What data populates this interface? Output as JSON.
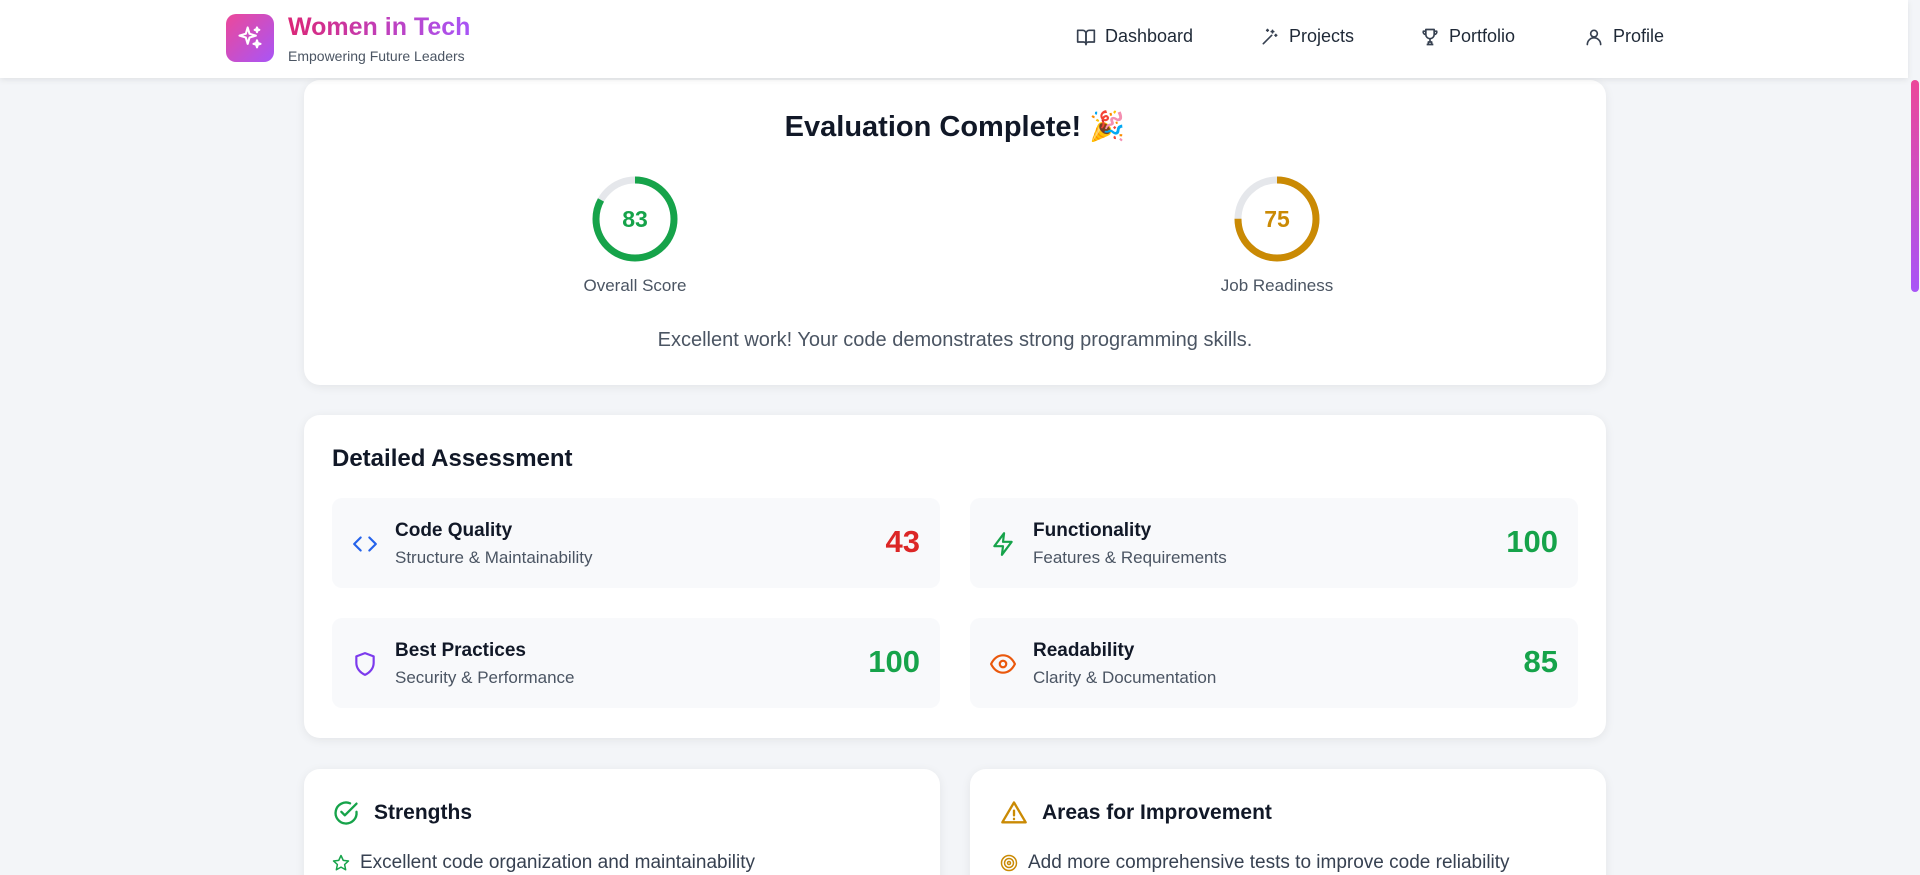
{
  "brand": {
    "title": "Women in Tech",
    "subtitle": "Empowering Future Leaders",
    "logo_icon": "sparkles-icon"
  },
  "nav": [
    {
      "label": "Dashboard",
      "icon": "book-open-icon"
    },
    {
      "label": "Projects",
      "icon": "wand-icon"
    },
    {
      "label": "Portfolio",
      "icon": "trophy-icon"
    },
    {
      "label": "Profile",
      "icon": "user-icon"
    }
  ],
  "evaluation": {
    "title": "Evaluation Complete! 🎉",
    "overall": {
      "value": 83,
      "label": "Overall Score",
      "color": "#16a34a"
    },
    "job_readiness": {
      "value": 75,
      "label": "Job Readiness",
      "color": "#ca8a04"
    },
    "message": "Excellent work! Your code demonstrates strong programming skills."
  },
  "assessment": {
    "title": "Detailed Assessment",
    "metrics": [
      {
        "name": "Code Quality",
        "sub": "Structure & Maintainability",
        "value": "43",
        "icon": "code-icon",
        "icon_color": "#2563eb",
        "value_color": "#dc2626"
      },
      {
        "name": "Functionality",
        "sub": "Features & Requirements",
        "value": "100",
        "icon": "zap-icon",
        "icon_color": "#16a34a",
        "value_color": "#16a34a"
      },
      {
        "name": "Best Practices",
        "sub": "Security & Performance",
        "value": "100",
        "icon": "shield-icon",
        "icon_color": "#7c3aed",
        "value_color": "#16a34a"
      },
      {
        "name": "Readability",
        "sub": "Clarity & Documentation",
        "value": "85",
        "icon": "eye-icon",
        "icon_color": "#ea580c",
        "value_color": "#16a34a"
      }
    ]
  },
  "strengths": {
    "title": "Strengths",
    "icon": "check-circle-icon",
    "items": [
      "Excellent code organization and maintainability"
    ]
  },
  "improvements": {
    "title": "Areas for Improvement",
    "icon": "alert-triangle-icon",
    "items": [
      "Add more comprehensive tests to improve code reliability"
    ]
  },
  "colors": {
    "accent_pink": "#ec4899",
    "accent_purple": "#a855f7",
    "ring_track": "#e5e7eb"
  }
}
